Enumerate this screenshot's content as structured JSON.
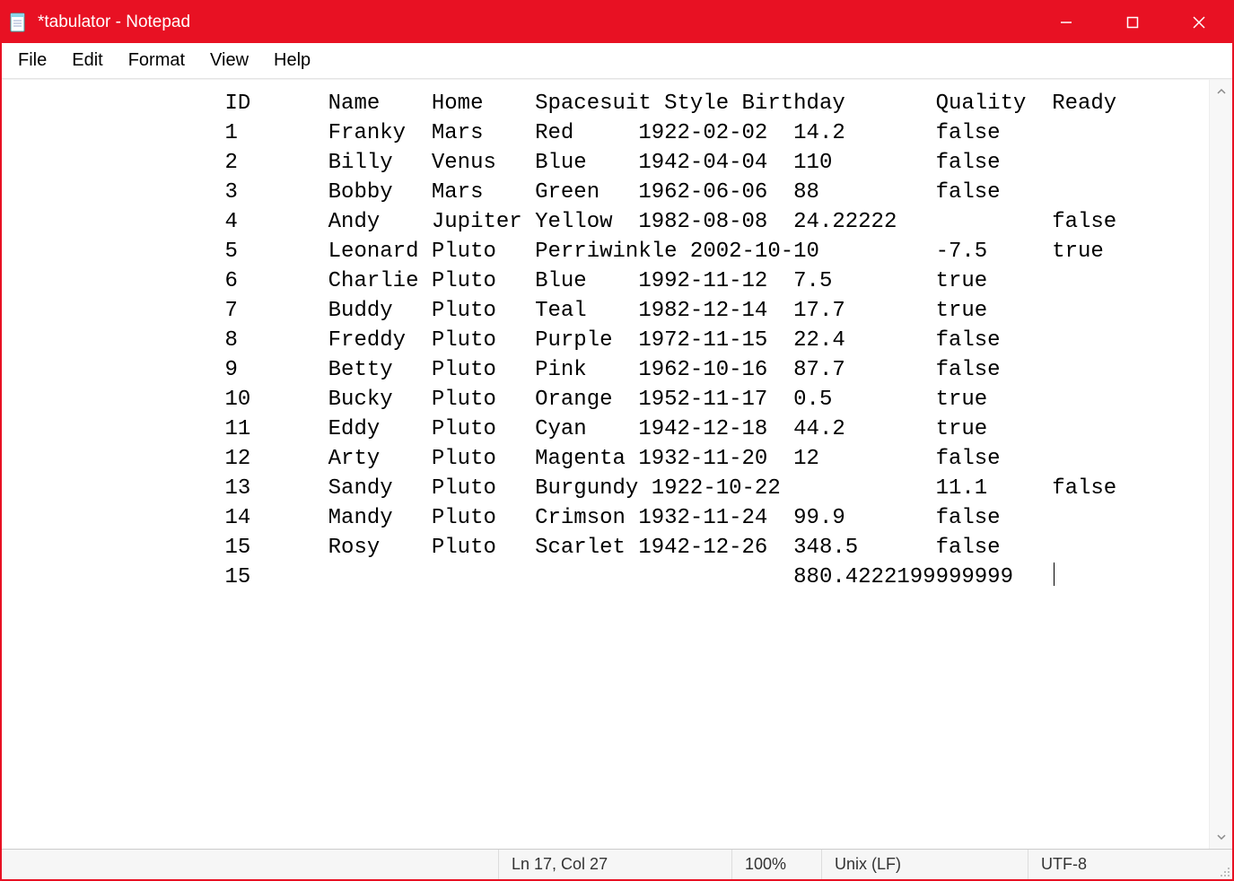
{
  "window": {
    "title": "*tabulator - Notepad"
  },
  "menu": {
    "items": [
      "File",
      "Edit",
      "Format",
      "View",
      "Help"
    ]
  },
  "editor": {
    "tab_stops": [
      9,
      17,
      25,
      33,
      41,
      49,
      61,
      72,
      81
    ],
    "columns": [
      "ID",
      "Name",
      "Home",
      "Spacesuit Style",
      "Birthday",
      "",
      "Quality",
      "Ready"
    ],
    "header_first_col": 1,
    "rows": [
      [
        "1",
        "Franky",
        "Mars",
        "Red",
        "1922-02-02",
        "14.2",
        "false",
        ""
      ],
      [
        "2",
        "Billy",
        "Venus",
        "Blue",
        "1942-04-04",
        "110",
        "false",
        ""
      ],
      [
        "3",
        "Bobby",
        "Mars",
        "Green",
        "1962-06-06",
        "88",
        "false",
        ""
      ],
      [
        "4",
        "Andy",
        "Jupiter",
        "Yellow",
        "1982-08-08",
        "24.22222",
        "",
        "false"
      ],
      [
        "5",
        "Leonard",
        "Pluto",
        "Perriwinkle",
        "2002-10-10",
        "",
        "-7.5",
        "true"
      ],
      [
        "6",
        "Charlie",
        "Pluto",
        "Blue",
        "1992-11-12",
        "7.5",
        "true",
        ""
      ],
      [
        "7",
        "Buddy",
        "Pluto",
        "Teal",
        "1982-12-14",
        "17.7",
        "true",
        ""
      ],
      [
        "8",
        "Freddy",
        "Pluto",
        "Purple",
        "1972-11-15",
        "22.4",
        "false",
        ""
      ],
      [
        "9",
        "Betty",
        "Pluto",
        "Pink",
        "1962-10-16",
        "87.7",
        "false",
        ""
      ],
      [
        "10",
        "Bucky",
        "Pluto",
        "Orange",
        "1952-11-17",
        "0.5",
        "true",
        ""
      ],
      [
        "11",
        "Eddy",
        "Pluto",
        "Cyan",
        "1942-12-18",
        "44.2",
        "true",
        ""
      ],
      [
        "12",
        "Arty",
        "Pluto",
        "Magenta",
        "1932-11-20",
        "12",
        "false",
        ""
      ],
      [
        "13",
        "Sandy",
        "Pluto",
        "Burgundy",
        "1922-10-22",
        "",
        "11.1",
        "false"
      ],
      [
        "14",
        "Mandy",
        "Pluto",
        "Crimson",
        "1932-11-24",
        "99.9",
        "false",
        ""
      ],
      [
        "15",
        "Rosy",
        "Pluto",
        "Scarlet",
        "1942-12-26",
        "348.5",
        "false",
        ""
      ]
    ],
    "footer": {
      "count": "15",
      "total": "880.4222199999999"
    },
    "footer_total_col": 5
  },
  "status": {
    "position": "Ln 17, Col 27",
    "zoom": "100%",
    "eol": "Unix (LF)",
    "encoding": "UTF-8"
  }
}
